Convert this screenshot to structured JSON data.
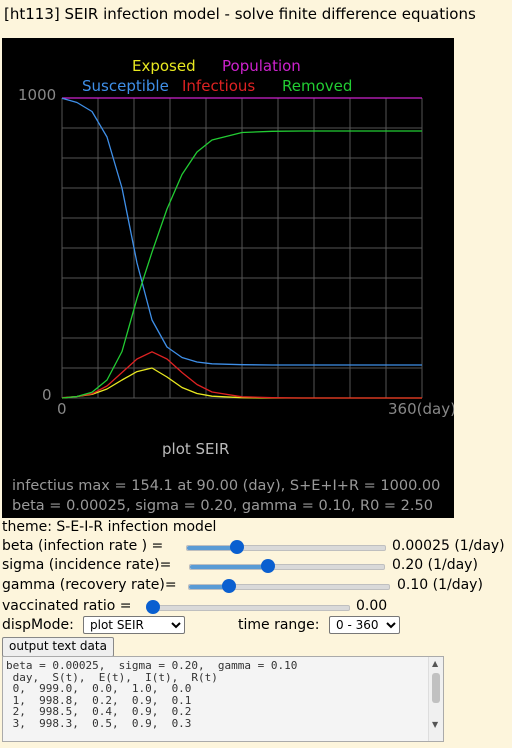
{
  "title": "[ht113] SEIR infection model - solve finite difference equations",
  "chart_data": {
    "type": "line",
    "x": [
      0,
      15,
      30,
      45,
      60,
      75,
      90,
      105,
      120,
      135,
      150,
      180,
      210,
      240,
      270,
      300,
      330,
      360
    ],
    "series": [
      {
        "name": "Population",
        "color": "#cc22cc",
        "values": [
          1000,
          1000,
          1000,
          1000,
          1000,
          1000,
          1000,
          1000,
          1000,
          1000,
          1000,
          1000,
          1000,
          1000,
          1000,
          1000,
          1000,
          1000
        ]
      },
      {
        "name": "Susceptible",
        "color": "#3f8fe8",
        "values": [
          999,
          985,
          955,
          870,
          700,
          450,
          260,
          170,
          135,
          120,
          114,
          111,
          110,
          110,
          110,
          110,
          110,
          110
        ]
      },
      {
        "name": "Exposed",
        "color": "#e8e820",
        "values": [
          0,
          5,
          12,
          30,
          60,
          88,
          100,
          70,
          35,
          15,
          6,
          1,
          0,
          0,
          0,
          0,
          0,
          0
        ]
      },
      {
        "name": "Infectious",
        "color": "#dd2222",
        "values": [
          1,
          5,
          14,
          40,
          85,
          130,
          154,
          130,
          85,
          45,
          20,
          4,
          1,
          0,
          0,
          0,
          0,
          0
        ]
      },
      {
        "name": "Removed",
        "color": "#22cc33",
        "values": [
          0,
          5,
          19,
          60,
          155,
          332,
          486,
          630,
          745,
          820,
          860,
          885,
          889,
          890,
          890,
          890,
          890,
          890
        ]
      }
    ],
    "ylim": [
      0,
      1000
    ],
    "xlim": [
      0,
      360
    ],
    "y_ticks": [
      "1000",
      "0"
    ],
    "x_ticks": [
      "0",
      "360(day)"
    ],
    "grid": true,
    "legend_row1": [
      "Exposed",
      "Population"
    ],
    "legend_row2": [
      "Susceptible",
      "Infectious",
      "Removed"
    ],
    "caption": "plot SEIR",
    "info_line1": "infectius max = 154.1 at 90.00 (day),  S+E+I+R = 1000.00",
    "info_line2": "beta = 0.00025,  sigma = 0.20,  gamma = 0.10,  R0 = 2.50"
  },
  "controls": {
    "theme": "theme: S-E-I-R infection model",
    "beta": {
      "label": "beta (infection rate ) =",
      "value": "0.00025 (1/day)",
      "position": 0.25
    },
    "sigma": {
      "label": "sigma (incidence rate)=",
      "value": "0.20 (1/day)",
      "position": 0.4
    },
    "gamma": {
      "label": "gamma (recovery rate)=",
      "value": "0.10 (1/day)",
      "position": 0.2
    },
    "vaccinated": {
      "label": "vaccinated ratio =",
      "value": "0.00",
      "position": 0.0
    },
    "dispmode_label": "dispMode:",
    "dispmode_value": "plot SEIR",
    "timerange_label": "time range:",
    "timerange_value": "0 - 360",
    "output_button": "output text data"
  },
  "output_text": "beta = 0.00025,  sigma = 0.20,  gamma = 0.10\n day,  S(t),  E(t),  I(t),  R(t)\n 0,  999.0,  0.0,  1.0,  0.0\n 1,  998.8,  0.2,  0.9,  0.1\n 2,  998.5,  0.4,  0.9,  0.2\n 3,  998.3,  0.5,  0.9,  0.3"
}
